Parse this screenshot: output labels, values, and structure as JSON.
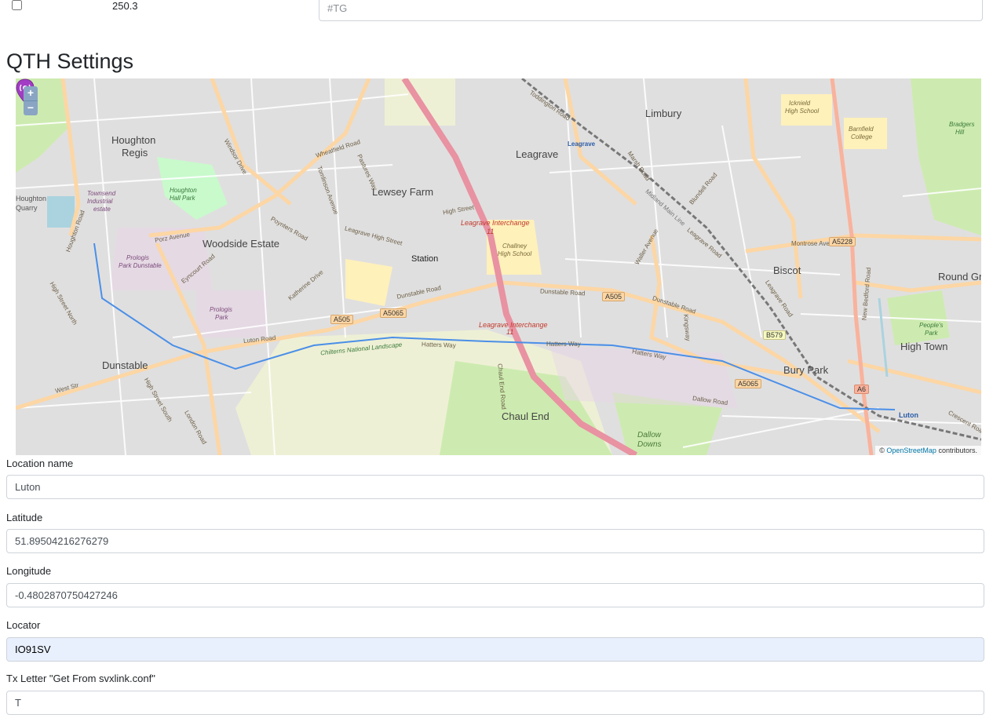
{
  "top_row": {
    "frequency": "250.3",
    "tg_placeholder": "#TG"
  },
  "section_title": "QTH Settings",
  "map": {
    "zoom_in": "+",
    "zoom_out": "−",
    "attribution_prefix": "©",
    "attribution_link": "OpenStreetMap",
    "attribution_suffix": "contributors.",
    "marker_label": "Station",
    "places": {
      "houghton_regis_1": "Houghton",
      "houghton_regis_2": "Regis",
      "limbury": "Limbury",
      "leagrave": "Leagrave",
      "lewsey_farm": "Lewsey Farm",
      "woodside_estate": "Woodside Estate",
      "dunstable": "Dunstable",
      "biscot": "Biscot",
      "round_green": "Round Gre",
      "high_town": "High Town",
      "bury_park": "Bury Park",
      "chaul_end": "Chaul End",
      "dallow_downs_1": "Dallow",
      "dallow_downs_2": "Downs",
      "luton": "Luton",
      "leagrave_station": "Leagrave",
      "leagrave_interchange": "Leagrave Interchange",
      "leagrave_interchange_2": "Leagrave Interchange",
      "chalney_school_1": "Challney",
      "chalney_school_2": "High School",
      "chilterns": "Chilterns National Landscape",
      "prologis_dunstable_1": "Prologis",
      "prologis_dunstable_2": "Park Dunstable",
      "prologis_park_1": "Prologis",
      "prologis_park_2": "Park",
      "townsend_1": "Townsend",
      "townsend_2": "Industrial",
      "townsend_3": "estate",
      "houghton_hall_1": "Houghton",
      "houghton_hall_2": "Hall Park",
      "houghton_quarry_1": "Houghton",
      "houghton_quarry_2": "Quarry",
      "icknield_1": "Icknield",
      "icknield_2": "High School",
      "barnfield_1": "Barnfield",
      "barnfield_2": "College",
      "peoples_park_1": "People's",
      "peoples_park_2": "Park",
      "bradgers_hill_1": "Bradgers",
      "bradgers_hill_2": "Hill"
    },
    "roads": {
      "dunstable_road": "Dunstable Road",
      "dunstable_road_2": "Dunstable Road",
      "dunstable_road_3": "Dunstable Road",
      "luton_road": "Luton Road",
      "hatters_way": "Hatters Way",
      "hatters_way_2": "Hatters Way",
      "hatters_way_3": "Hatters Way",
      "high_street": "High Street",
      "leagrave_high_street": "Leagrave High Street",
      "poynters_road": "Poynters Road",
      "porz_avenue": "Porz Avenue",
      "eyncourt_road": "Eyncourt Road",
      "katherine_drive": "Katherine Drive",
      "montrose_avenue": "Montrose Avenue",
      "leagrave_road": "Leagrave Road",
      "leagrave_road_2": "Leagrave Road",
      "marsh_road": "Marsh Road",
      "waller_avenue": "Waller Avenue",
      "blundell_road": "Blundell Road",
      "new_bedford_road": "New Bedford Road",
      "wheatfield_road": "Wheatfield Road",
      "tomlinson_avenue": "Tomlinson Avenue",
      "pastures_way": "Pastures Way",
      "windsor_drive": "Windsor Drive",
      "high_street_north": "High Street North",
      "high_street_south": "High Street South",
      "houghton_road": "Houghton Road",
      "london_road": "London Road",
      "west_st": "West Str",
      "chaul_end_road": "Chaul End Road",
      "dallow_road": "Dallow Road",
      "kingsway": "Kingsway",
      "toddington_road": "Toddington Road",
      "crescent_road": "Crescent Road",
      "midland_main_line": "Midland Main Line",
      "a505": "A505",
      "a505_2": "A505",
      "a5065": "A5065",
      "a5065_2": "A5065",
      "a5228": "A5228",
      "b579": "B579",
      "a6": "A6",
      "j11": "11",
      "j11_2": "11"
    }
  },
  "form": {
    "location_name": {
      "label": "Location name",
      "value": "Luton"
    },
    "latitude": {
      "label": "Latitude",
      "value": "51.89504216276279"
    },
    "longitude": {
      "label": "Longitude",
      "value": "-0.4802870750427246"
    },
    "locator": {
      "label": "Locator",
      "value": "IO91SV"
    },
    "tx_letter": {
      "label": "Tx Letter \"Get From svxlink.conf\"",
      "value": "T"
    }
  },
  "colors": {
    "map_bg": "#f2efe9",
    "motorway": "#e892a2",
    "primary_road": "#fcd6a4",
    "trunk_road": "#f9b29c",
    "railway": "#777777",
    "river": "#4a8fe8",
    "park": "#c8facc",
    "marker": "#a23cc4",
    "locator_autofill": "#e8f0fe"
  }
}
